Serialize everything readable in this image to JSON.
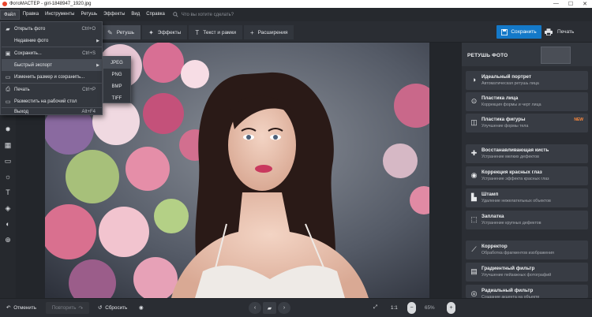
{
  "titlebar": {
    "title": "ФотоМАСТЕР - girl-1848947_1920.jpg",
    "min": "—",
    "max": "☐",
    "close": "✕"
  },
  "menu": {
    "items": [
      "Файл",
      "Правка",
      "Инструменты",
      "Ретушь",
      "Эффекты",
      "Вид",
      "Справка"
    ],
    "search_placeholder": "Что вы хотите сделать?"
  },
  "tabs": [
    {
      "label": "Ретушь",
      "icon": "brush-icon"
    },
    {
      "label": "Эффекты",
      "icon": "magic-wand-icon"
    },
    {
      "label": "Текст и рамки",
      "icon": "text-icon"
    },
    {
      "label": "Расширения",
      "icon": "plus-icon"
    }
  ],
  "toolbar": {
    "save_label": "Сохранить",
    "print_label": "Печать"
  },
  "file_menu": {
    "items": [
      {
        "label": "Открыть фото",
        "shortcut": "Ctrl+O"
      },
      {
        "label": "Недавние фото",
        "shortcut": ""
      },
      {
        "label": "Сохранить...",
        "shortcut": "Ctrl+S"
      },
      {
        "label": "Быстрый экспорт",
        "shortcut": ""
      },
      {
        "label": "Изменить размер и сохранить...",
        "shortcut": ""
      },
      {
        "label": "Печать",
        "shortcut": "Ctrl+P"
      },
      {
        "label": "Разместить на рабочий стол",
        "shortcut": ""
      },
      {
        "label": "Выход",
        "shortcut": "Alt+F4"
      }
    ]
  },
  "export_submenu": [
    "JPEG",
    "PNG",
    "BMP",
    "TIFF"
  ],
  "right_panel": {
    "title": "РЕТУШЬ ФОТО",
    "tools": [
      {
        "title": "Идеальный портрет",
        "subtitle": "Автоматическая ретушь лица",
        "badge": ""
      },
      {
        "title": "Пластика лица",
        "subtitle": "Коррекция формы и черт лица",
        "badge": ""
      },
      {
        "title": "Пластика фигуры",
        "subtitle": "Улучшение формы тела",
        "badge": "NEW"
      },
      {
        "title": "Восстанавливающая кисть",
        "subtitle": "Устранение мелких дефектов",
        "badge": ""
      },
      {
        "title": "Коррекция красных глаз",
        "subtitle": "Устранение эффекта красных глаз",
        "badge": ""
      },
      {
        "title": "Штамп",
        "subtitle": "Удаление нежелательных объектов",
        "badge": ""
      },
      {
        "title": "Заплатка",
        "subtitle": "Устранение крупных дефектов",
        "badge": ""
      },
      {
        "title": "Корректор",
        "subtitle": "Обработка фрагментов изображения",
        "badge": ""
      },
      {
        "title": "Градиентный фильтр",
        "subtitle": "Улучшение пейзажных фотографий",
        "badge": ""
      },
      {
        "title": "Радиальный фильтр",
        "subtitle": "Создание акцента на объекте",
        "badge": ""
      }
    ]
  },
  "bottom": {
    "undo": "Отменить",
    "redo": "Повторить",
    "reset": "Сбросить",
    "zoom_ratio": "1:1",
    "zoom_value": "65%"
  }
}
